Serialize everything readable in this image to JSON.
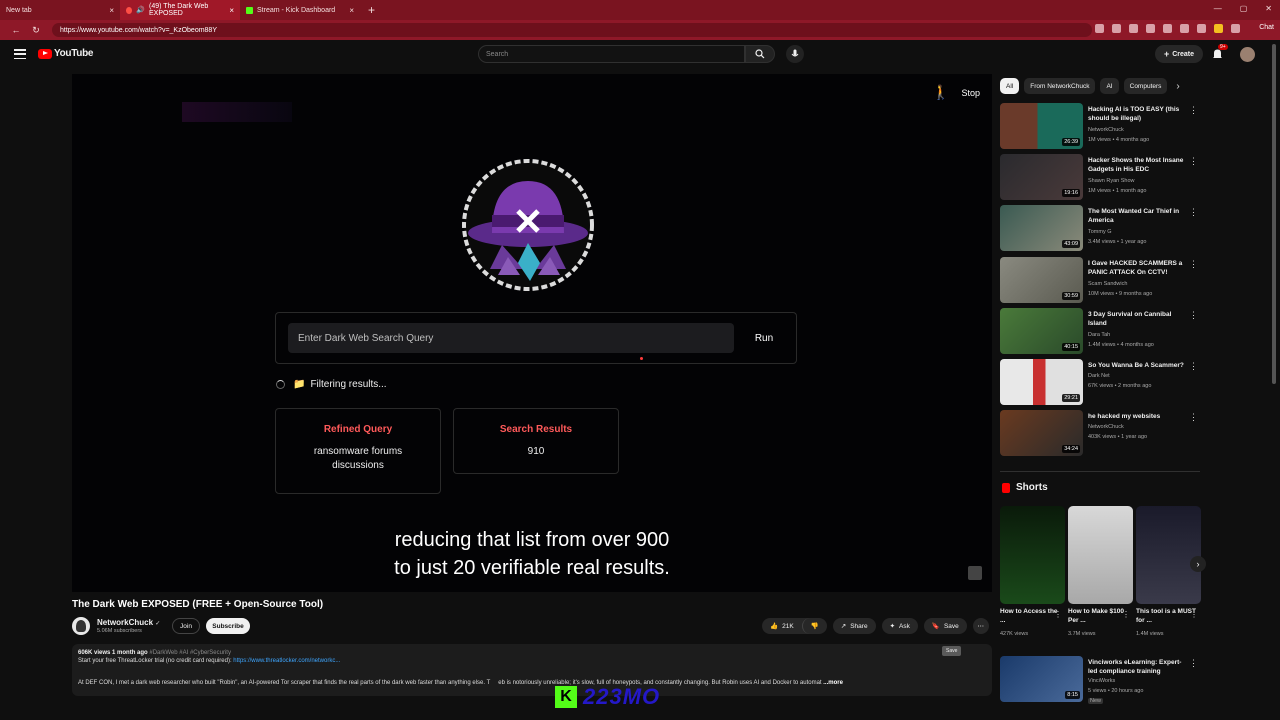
{
  "browser": {
    "tabs": [
      {
        "label": "New tab"
      },
      {
        "label": "(49) The Dark Web EXPOSED"
      },
      {
        "label": "Stream - Kick Dashboard"
      }
    ],
    "url": "https://www.youtube.com/watch?v=_KzObeom88Y",
    "chat_label": "Chat"
  },
  "header": {
    "logo_text": "YouTube",
    "search_placeholder": "Search",
    "create_label": "Create",
    "notif_count": "9+"
  },
  "video": {
    "stop_label": "Stop",
    "query_placeholder": "Enter Dark Web Search Query",
    "run_label": "Run",
    "status_text": "Filtering results...",
    "card1_title": "Refined Query",
    "card1_value": "ransomware forums discussions",
    "card2_title": "Search Results",
    "card2_value": "910",
    "subtitle_line1": "reducing that list from over 900",
    "subtitle_line2": "to just 20 verifiable real results."
  },
  "info": {
    "title": "The Dark Web EXPOSED (FREE + Open-Source Tool)",
    "channel": "NetworkChuck",
    "subscribers": "5.06M subscribers",
    "join": "Join",
    "subscribe": "Subscribe",
    "likes": "21K",
    "share": "Share",
    "ask": "Ask",
    "save": "Save",
    "save_tooltip": "Save",
    "desc_meta": "606K views  1 month ago",
    "desc_tags": "#DarkWeb #AI #CyberSecurity",
    "desc_line2": "Start your free ThreatLocker trial (no credit card required): ",
    "desc_link": "https://www.threatlocker.com/networkc...",
    "desc_line3a": "At DEF CON, I met a dark web researcher who built \"Robin\", an AI-powered Tor scraper that finds the real parts of the dark web faster than anything else. T",
    "desc_line3b": "eb is notoriously unreliable; it's slow, full of honeypots, and constantly changing. But Robin uses AI and Docker to automat",
    "desc_more": "...more",
    "kick_number": "223MO"
  },
  "sidebar": {
    "chips": [
      "All",
      "From NetworkChuck",
      "AI",
      "Computers"
    ],
    "recs": [
      {
        "title": "Hacking AI is TOO EASY (this should be illegal)",
        "channel": "NetworkChuck",
        "meta": "1M views • 4 months ago",
        "duration": "26:39",
        "color": "#5a2a2a"
      },
      {
        "title": "Hacker Shows the Most Insane Gadgets in His EDC",
        "channel": "Shawn Ryan Show",
        "meta": "1M views • 1 month ago",
        "duration": "19:16",
        "color": "#2c2c30"
      },
      {
        "title": "The Most Wanted Car Thief in America",
        "channel": "Tommy G",
        "meta": "3.4M views • 1 year ago",
        "duration": "43:09",
        "color": "#3a4640"
      },
      {
        "title": "I Gave HACKED SCAMMERS a PANIC ATTACK On CCTV!",
        "channel": "Scam Sandwich",
        "meta": "10M views • 9 months ago",
        "duration": "30:59",
        "color": "#6a6a60"
      },
      {
        "title": "3 Day Survival on Cannibal Island",
        "channel": "Dara Tah",
        "meta": "1.4M views • 4 months ago",
        "duration": "40:15",
        "color": "#3c5a30"
      },
      {
        "title": "So You Wanna Be A Scammer?",
        "channel": "Dark Net",
        "meta": "67K views • 2 months ago",
        "duration": "29:21",
        "color": "#d8d8d8"
      },
      {
        "title": "he hacked my websites",
        "channel": "NetworkChuck",
        "meta": "403K views • 1 year ago",
        "duration": "34:24",
        "color": "#5a3020"
      }
    ],
    "shorts_title": "Shorts",
    "shorts": [
      {
        "title": "How to Access the ...",
        "views": "427K views",
        "color": "#0a2a10"
      },
      {
        "title": "How to Make $100 Per ...",
        "views": "3.7M views",
        "color": "#cfcfcf"
      },
      {
        "title": "This tool is a MUST for ...",
        "views": "1.4M views",
        "color": "#1a1a2a"
      }
    ],
    "ad_title": "Vinciworks eLearning: Expert-led compliance training",
    "ad_channel": "VinciWorks",
    "ad_meta": "5 views • 20 hours ago",
    "ad_badge": "New",
    "ad_duration": "8:15"
  }
}
